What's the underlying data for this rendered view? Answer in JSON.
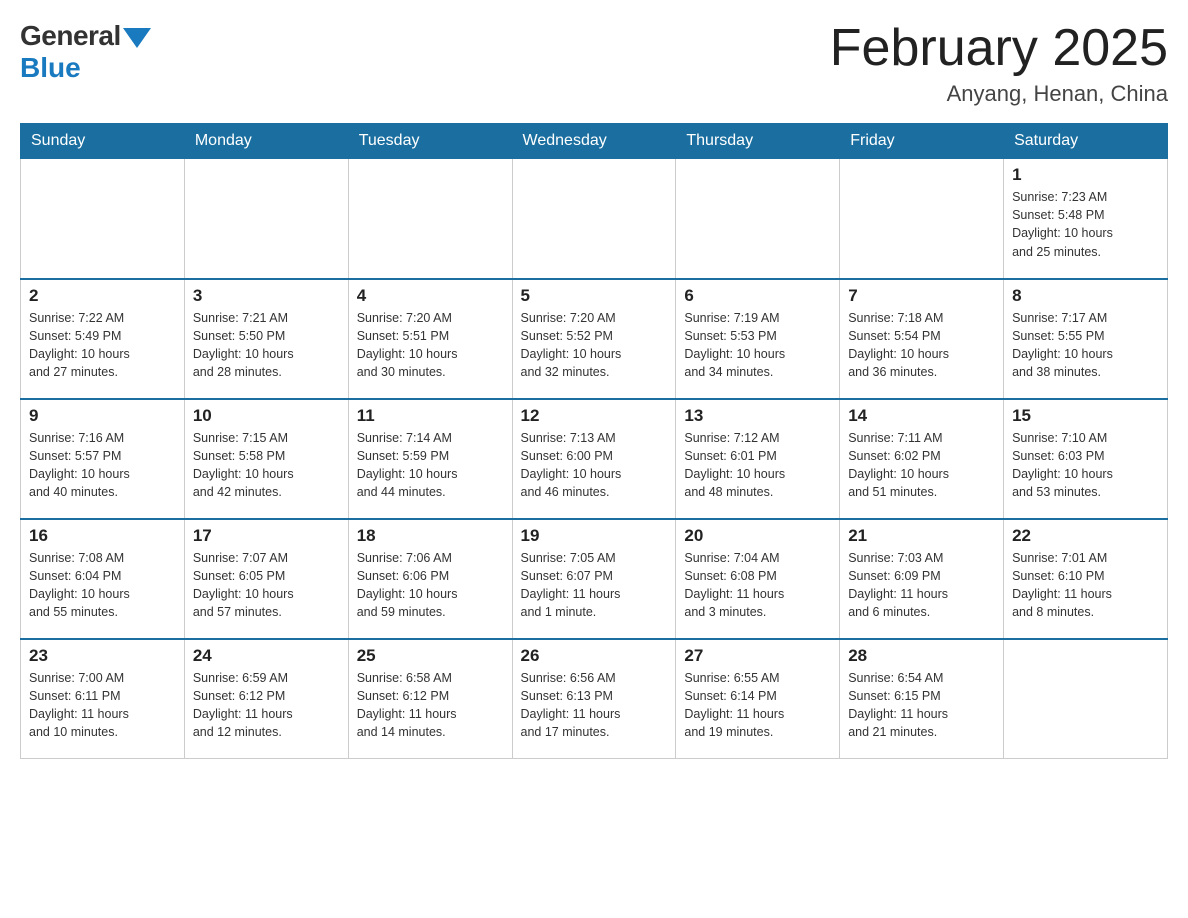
{
  "header": {
    "logo_general": "General",
    "logo_blue": "Blue",
    "month_title": "February 2025",
    "location": "Anyang, Henan, China"
  },
  "weekdays": [
    "Sunday",
    "Monday",
    "Tuesday",
    "Wednesday",
    "Thursday",
    "Friday",
    "Saturday"
  ],
  "weeks": [
    [
      {
        "day": "",
        "info": ""
      },
      {
        "day": "",
        "info": ""
      },
      {
        "day": "",
        "info": ""
      },
      {
        "day": "",
        "info": ""
      },
      {
        "day": "",
        "info": ""
      },
      {
        "day": "",
        "info": ""
      },
      {
        "day": "1",
        "info": "Sunrise: 7:23 AM\nSunset: 5:48 PM\nDaylight: 10 hours\nand 25 minutes."
      }
    ],
    [
      {
        "day": "2",
        "info": "Sunrise: 7:22 AM\nSunset: 5:49 PM\nDaylight: 10 hours\nand 27 minutes."
      },
      {
        "day": "3",
        "info": "Sunrise: 7:21 AM\nSunset: 5:50 PM\nDaylight: 10 hours\nand 28 minutes."
      },
      {
        "day": "4",
        "info": "Sunrise: 7:20 AM\nSunset: 5:51 PM\nDaylight: 10 hours\nand 30 minutes."
      },
      {
        "day": "5",
        "info": "Sunrise: 7:20 AM\nSunset: 5:52 PM\nDaylight: 10 hours\nand 32 minutes."
      },
      {
        "day": "6",
        "info": "Sunrise: 7:19 AM\nSunset: 5:53 PM\nDaylight: 10 hours\nand 34 minutes."
      },
      {
        "day": "7",
        "info": "Sunrise: 7:18 AM\nSunset: 5:54 PM\nDaylight: 10 hours\nand 36 minutes."
      },
      {
        "day": "8",
        "info": "Sunrise: 7:17 AM\nSunset: 5:55 PM\nDaylight: 10 hours\nand 38 minutes."
      }
    ],
    [
      {
        "day": "9",
        "info": "Sunrise: 7:16 AM\nSunset: 5:57 PM\nDaylight: 10 hours\nand 40 minutes."
      },
      {
        "day": "10",
        "info": "Sunrise: 7:15 AM\nSunset: 5:58 PM\nDaylight: 10 hours\nand 42 minutes."
      },
      {
        "day": "11",
        "info": "Sunrise: 7:14 AM\nSunset: 5:59 PM\nDaylight: 10 hours\nand 44 minutes."
      },
      {
        "day": "12",
        "info": "Sunrise: 7:13 AM\nSunset: 6:00 PM\nDaylight: 10 hours\nand 46 minutes."
      },
      {
        "day": "13",
        "info": "Sunrise: 7:12 AM\nSunset: 6:01 PM\nDaylight: 10 hours\nand 48 minutes."
      },
      {
        "day": "14",
        "info": "Sunrise: 7:11 AM\nSunset: 6:02 PM\nDaylight: 10 hours\nand 51 minutes."
      },
      {
        "day": "15",
        "info": "Sunrise: 7:10 AM\nSunset: 6:03 PM\nDaylight: 10 hours\nand 53 minutes."
      }
    ],
    [
      {
        "day": "16",
        "info": "Sunrise: 7:08 AM\nSunset: 6:04 PM\nDaylight: 10 hours\nand 55 minutes."
      },
      {
        "day": "17",
        "info": "Sunrise: 7:07 AM\nSunset: 6:05 PM\nDaylight: 10 hours\nand 57 minutes."
      },
      {
        "day": "18",
        "info": "Sunrise: 7:06 AM\nSunset: 6:06 PM\nDaylight: 10 hours\nand 59 minutes."
      },
      {
        "day": "19",
        "info": "Sunrise: 7:05 AM\nSunset: 6:07 PM\nDaylight: 11 hours\nand 1 minute."
      },
      {
        "day": "20",
        "info": "Sunrise: 7:04 AM\nSunset: 6:08 PM\nDaylight: 11 hours\nand 3 minutes."
      },
      {
        "day": "21",
        "info": "Sunrise: 7:03 AM\nSunset: 6:09 PM\nDaylight: 11 hours\nand 6 minutes."
      },
      {
        "day": "22",
        "info": "Sunrise: 7:01 AM\nSunset: 6:10 PM\nDaylight: 11 hours\nand 8 minutes."
      }
    ],
    [
      {
        "day": "23",
        "info": "Sunrise: 7:00 AM\nSunset: 6:11 PM\nDaylight: 11 hours\nand 10 minutes."
      },
      {
        "day": "24",
        "info": "Sunrise: 6:59 AM\nSunset: 6:12 PM\nDaylight: 11 hours\nand 12 minutes."
      },
      {
        "day": "25",
        "info": "Sunrise: 6:58 AM\nSunset: 6:12 PM\nDaylight: 11 hours\nand 14 minutes."
      },
      {
        "day": "26",
        "info": "Sunrise: 6:56 AM\nSunset: 6:13 PM\nDaylight: 11 hours\nand 17 minutes."
      },
      {
        "day": "27",
        "info": "Sunrise: 6:55 AM\nSunset: 6:14 PM\nDaylight: 11 hours\nand 19 minutes."
      },
      {
        "day": "28",
        "info": "Sunrise: 6:54 AM\nSunset: 6:15 PM\nDaylight: 11 hours\nand 21 minutes."
      },
      {
        "day": "",
        "info": ""
      }
    ]
  ]
}
